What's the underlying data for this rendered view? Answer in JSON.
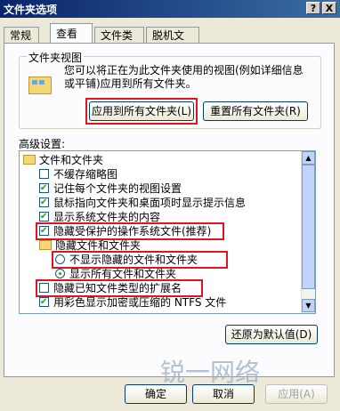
{
  "window": {
    "title": "文件夹选项",
    "help_btn": "?",
    "close_btn": "X"
  },
  "tabs": [
    {
      "label": "常规"
    },
    {
      "label": "查看"
    },
    {
      "label": "文件类型"
    },
    {
      "label": "脱机文件"
    }
  ],
  "folder_view": {
    "group_label": "文件夹视图",
    "description": "您可以将正在为此文件夹使用的视图(例如详细信息或平铺)应用到所有文件夹。",
    "apply_all_btn": "应用到所有文件夹(L)",
    "reset_all_btn": "重置所有文件夹(R)"
  },
  "advanced": {
    "label": "高级设置:",
    "items": [
      {
        "type": "folder",
        "text": "文件和文件夹",
        "indent": 0
      },
      {
        "type": "checkbox",
        "text": "不缓存缩略图",
        "checked": false,
        "indent": 1
      },
      {
        "type": "checkbox",
        "text": "记住每个文件夹的视图设置",
        "checked": true,
        "indent": 1
      },
      {
        "type": "checkbox",
        "text": "鼠标指向文件夹和桌面项时显示提示信息",
        "checked": true,
        "indent": 1
      },
      {
        "type": "checkbox",
        "text": "显示系统文件夹的内容",
        "checked": true,
        "indent": 1
      },
      {
        "type": "checkbox",
        "text": "隐藏受保护的操作系统文件(推荐)",
        "checked": true,
        "indent": 1
      },
      {
        "type": "folder",
        "text": "隐藏文件和文件夹",
        "indent": 1
      },
      {
        "type": "radio",
        "text": "不显示隐藏的文件和文件夹",
        "checked": false,
        "indent": 2
      },
      {
        "type": "radio",
        "text": "显示所有文件和文件夹",
        "checked": true,
        "indent": 2
      },
      {
        "type": "checkbox",
        "text": "隐藏已知文件类型的扩展名",
        "checked": false,
        "indent": 1
      },
      {
        "type": "checkbox",
        "text": "用彩色显示加密或压缩的 NTFS 文件",
        "checked": true,
        "indent": 1
      }
    ]
  },
  "restore_default_btn": "还原为默认值(D)",
  "footer": {
    "ok": "确定",
    "cancel": "取消",
    "apply": "应用(A)"
  },
  "watermark": "锐一网络"
}
